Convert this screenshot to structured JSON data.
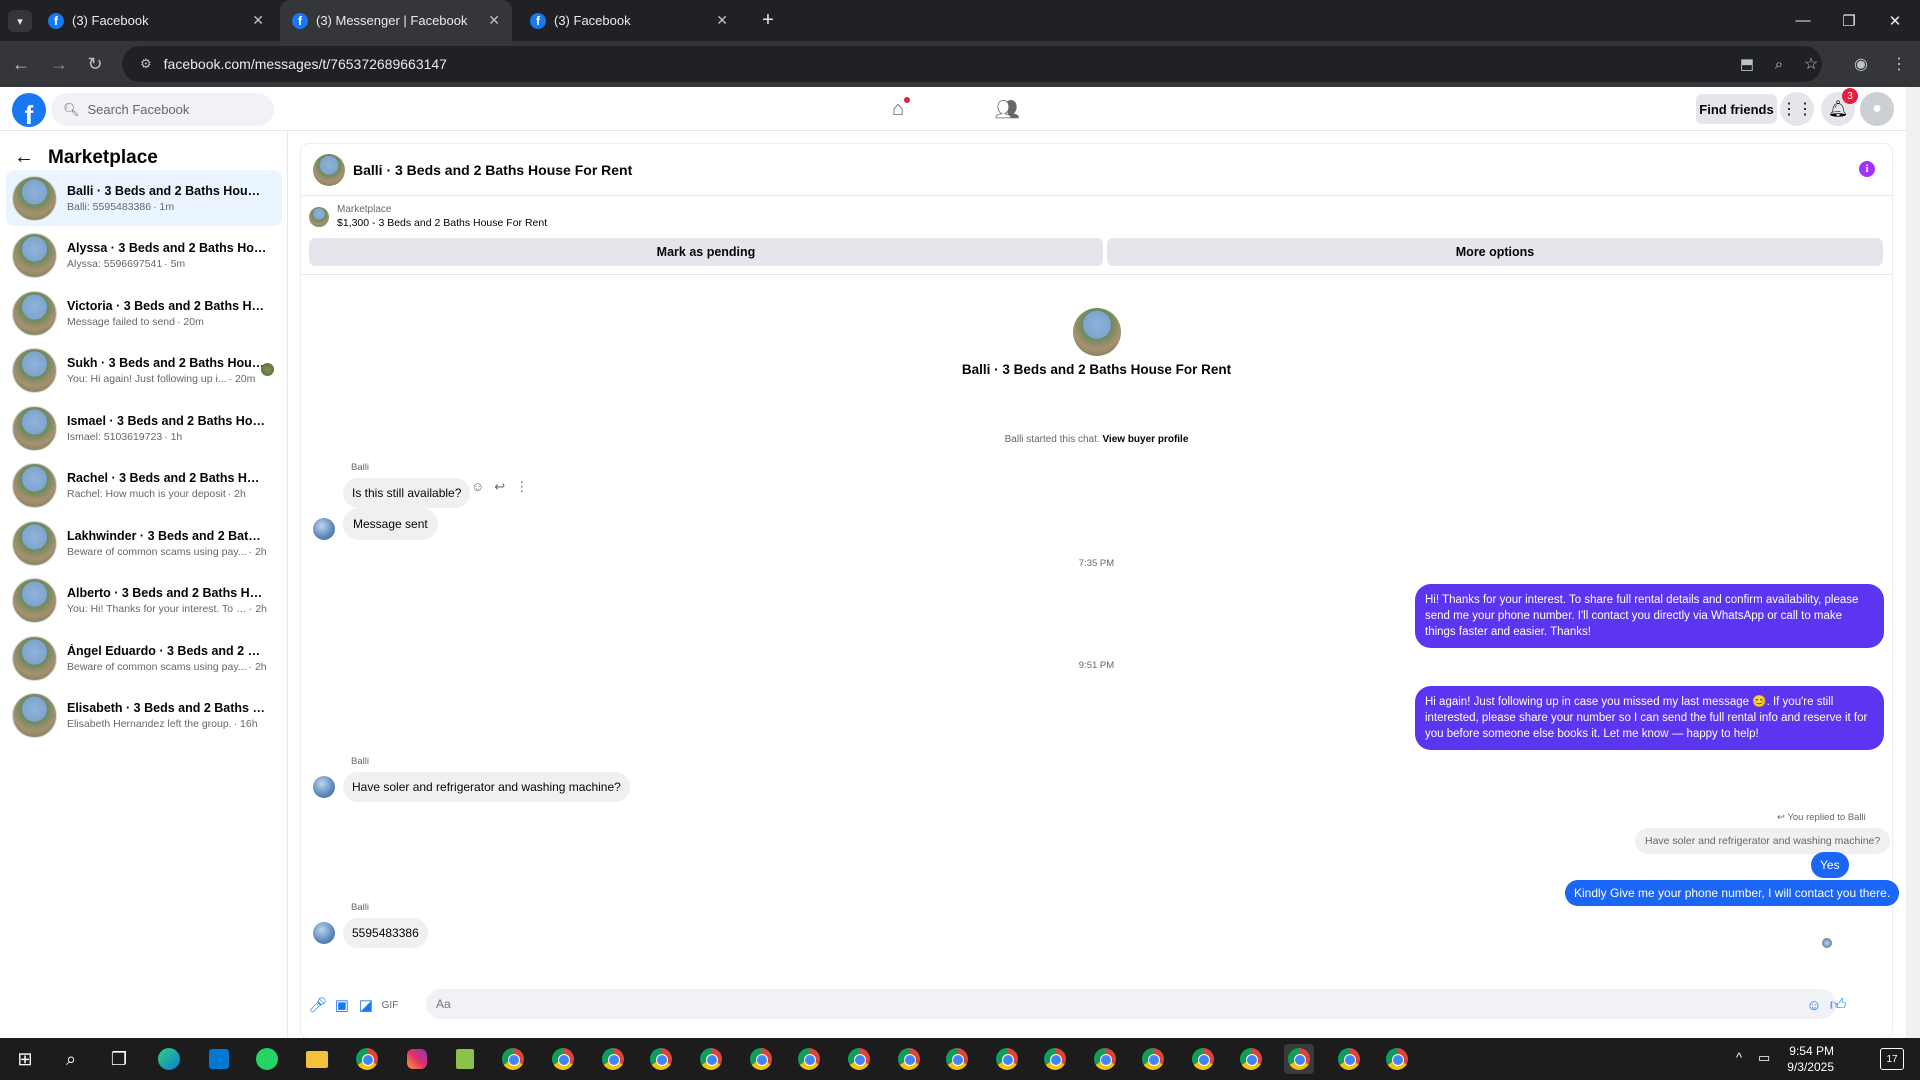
{
  "browser": {
    "tabs": [
      {
        "label": "(3) Facebook",
        "active": false
      },
      {
        "label": "(3) Messenger | Facebook",
        "active": true
      },
      {
        "label": "(3) Facebook",
        "active": false
      }
    ],
    "url": "facebook.com/messages/t/765372689663147"
  },
  "header": {
    "search_placeholder": "Search Facebook",
    "find_friends": "Find friends",
    "notification_count": "3"
  },
  "sidebar": {
    "title": "Marketplace",
    "conversations": [
      {
        "name": "Balli · 3 Beds and 2 Baths House F...",
        "snippet": "Balli: 5595483386",
        "time": "· 1m",
        "active": true
      },
      {
        "name": "Alyssa · 3 Beds and 2 Baths House ...",
        "snippet": "Alyssa: 5596697541",
        "time": "· 5m"
      },
      {
        "name": "Victoria · 3 Beds and 2 Baths Hous...",
        "snippet": "Message failed to send",
        "time": "· 20m"
      },
      {
        "name": "Sukh · 3 Beds and 2 Baths Hous...",
        "snippet": "You: Hi again! Just following up i...",
        "time": "· 20m"
      },
      {
        "name": "Ismael · 3 Beds and 2 Baths House...",
        "snippet": "Ismael: 5103619723",
        "time": "· 1h"
      },
      {
        "name": "Rachel · 3 Beds and 2 Baths House...",
        "snippet": "Rachel: How much is your deposit",
        "time": "· 2h"
      },
      {
        "name": "Lakhwinder · 3 Beds and 2 Baths H...",
        "snippet": "Beware of common scams using pay...",
        "time": "· 2h"
      },
      {
        "name": "Alberto · 3 Beds and 2 Baths Hous...",
        "snippet": "You: Hi! Thanks for your interest. To sh...",
        "time": "· 2h"
      },
      {
        "name": "Ángel Eduardo · 3 Beds and 2 Bath...",
        "snippet": "Beware of common scams using pay...",
        "time": "· 2h"
      },
      {
        "name": "Elisabeth · 3 Beds and 2 Baths Hou...",
        "snippet": "Elisabeth Hernandez left the group.",
        "time": "· 16h"
      }
    ]
  },
  "chat": {
    "title": "Balli · 3 Beds and 2 Baths House For Rent",
    "listing_label": "Marketplace",
    "listing_detail": "$1,300 - 3 Beds and 2 Baths House For Rent",
    "mark_pending": "Mark as pending",
    "more_options": "More options",
    "intro_title": "Balli · 3 Beds and 2 Baths House For Rent",
    "started_text": "Balli started this chat.",
    "view_profile": "View buyer profile",
    "messages": {
      "sender": "Balli",
      "m1": "Is this still available?",
      "m2": "Message sent",
      "t1": "7:35 PM",
      "out1": "Hi! Thanks for your interest. To share full rental details and confirm availability, please send me your phone number. I'll contact you directly via WhatsApp or call to make things faster and easier. Thanks!",
      "t2": "9:51 PM",
      "out2": "Hi again! Just following up in case you missed my last message 😊. If you're still interested, please share your number so I can send the full rental info and reserve it for you before someone else books it. Let me know — happy to help!",
      "m3": "Have soler and refrigerator and washing machine?",
      "replied_label": "You replied to Balli",
      "quoted": "Have soler and refrigerator and washing machine?",
      "out3": "Yes",
      "out4": "Kindly Give me your phone number, I will contact you there.",
      "m4": "5595483386"
    },
    "composer_placeholder": "Aa"
  },
  "taskbar": {
    "time": "9:54 PM",
    "date": "9/3/2025",
    "notif_count": "17"
  }
}
